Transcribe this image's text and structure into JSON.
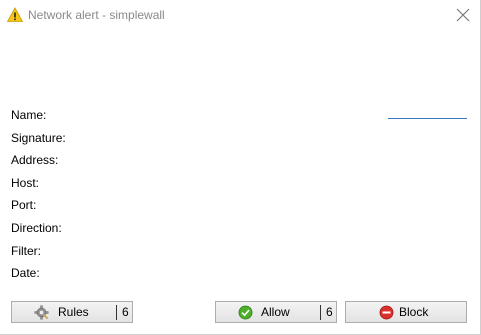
{
  "window": {
    "title": "Network alert - simplewall",
    "icon": "warning-icon",
    "close_icon": "close-icon"
  },
  "details": {
    "labels": [
      "Name:",
      "Signature:",
      "Address:",
      "Host:",
      "Port:",
      "Direction:",
      "Filter:",
      "Date:"
    ]
  },
  "buttons": {
    "rules": {
      "label": "Rules",
      "count": "6",
      "icon": "gear-icon"
    },
    "allow": {
      "label": "Allow",
      "count": "6",
      "icon": "check-icon"
    },
    "block": {
      "label": "Block",
      "icon": "block-icon"
    }
  },
  "colors": {
    "title_text": "#8a8a8a",
    "link_underline": "#3b78c6",
    "allow_green": "#4caf2a",
    "block_red": "#d9302b",
    "warning_yellow": "#f5c518"
  }
}
